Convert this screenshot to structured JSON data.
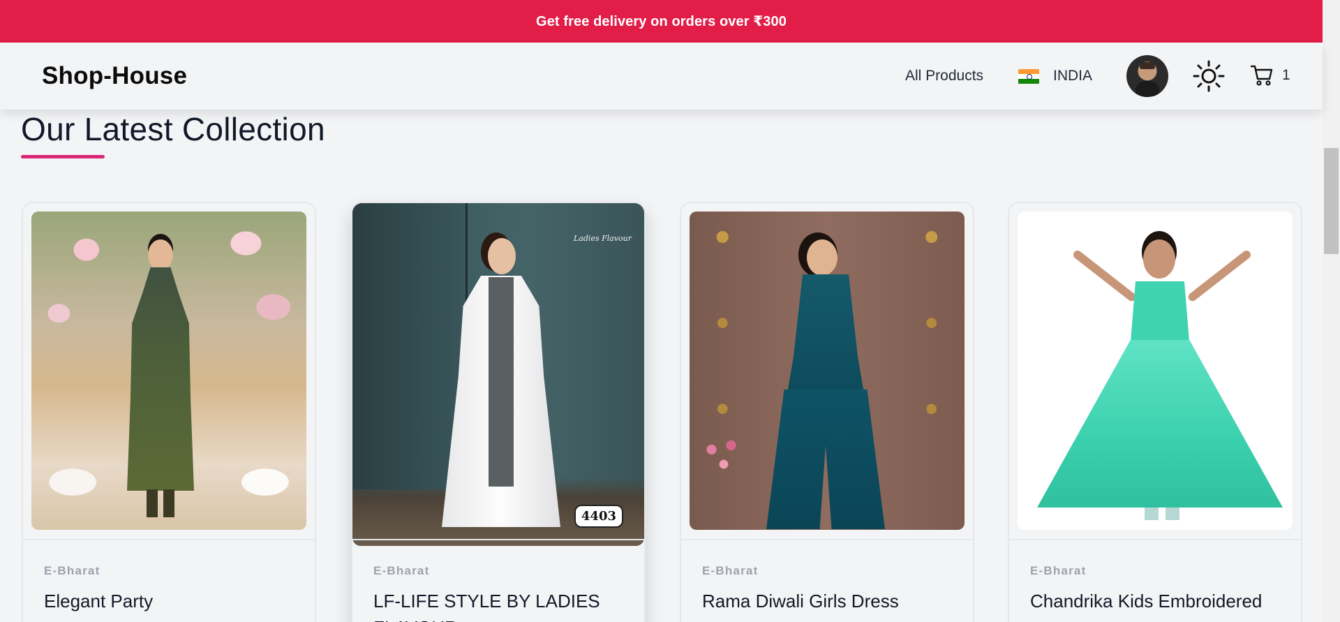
{
  "announcement": {
    "text": "Get free delivery on orders over ₹300"
  },
  "header": {
    "logo": "Shop-House",
    "nav_all_products": "All Products",
    "country": "INDIA",
    "cart_count": "1"
  },
  "section": {
    "title": "Our Latest Collection"
  },
  "products": [
    {
      "brand": "E-Bharat",
      "name": "Elegant Party"
    },
    {
      "brand": "E-Bharat",
      "name": "LF-LIFE STYLE BY LADIES FLAVOUR",
      "badge": "4403",
      "logo_text": "Ladies Flavour"
    },
    {
      "brand": "E-Bharat",
      "name": "Rama Diwali Girls Dress"
    },
    {
      "brand": "E-Bharat",
      "name": "Chandrika Kids Embroidered"
    }
  ],
  "icons": {
    "theme": "sun-icon",
    "cart": "shopping-cart-icon",
    "flag": "india-flag-icon",
    "user": "avatar"
  },
  "colors": {
    "announcement_bg": "#e11d48",
    "accent_underline": "#db2777",
    "header_bg": "#f3f4f6"
  }
}
